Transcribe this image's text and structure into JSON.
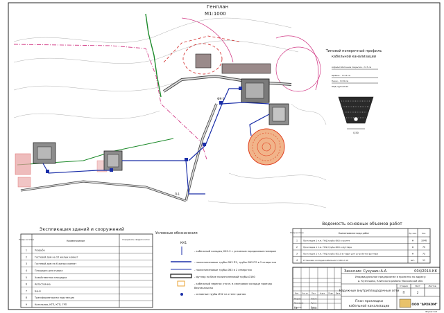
{
  "plan": {
    "title": "Генплан",
    "scale": "М1:1000",
    "road_label": "ФК-1",
    "pipe_label": "П-1"
  },
  "profile": {
    "title": "Типовой поперечный профиль",
    "subtitle": "кабельной канализации",
    "label_1": "Асфальтобетонное покрытие – h=5 см",
    "label_2": "Щебень – h=15 см",
    "label_3": "Песок – h=30 см",
    "label_4": "ПНД труба Ø110",
    "width": "0,50"
  },
  "explication": {
    "title": "Экспликация зданий и сооружений",
    "headers": [
      "Номер на плане",
      "Наименование",
      "Координаты квадрата сетки"
    ],
    "rows": [
      {
        "num": "1",
        "name": "Усадьба"
      },
      {
        "num": "2",
        "name": "Гостевой дом на 10 жилых комнат"
      },
      {
        "num": "3",
        "name": "Гостевой дом на 6 жилых комнат"
      },
      {
        "num": "4",
        "name": "Площадка для отдыха"
      },
      {
        "num": "5",
        "name": "Хозяйственная площадка"
      },
      {
        "num": "6",
        "name": "Автостоянка"
      },
      {
        "num": "7",
        "name": "Баня"
      },
      {
        "num": "8",
        "name": "Трансформаторная подстанция"
      },
      {
        "num": "9",
        "name": "Котельная, КТП, КТП, ГРП"
      }
    ]
  },
  "legend": {
    "title": "Условные обозначения",
    "well_code": "КК1",
    "items": [
      "- кабельный колодец ККС-2 с условным порядковым номером",
      "- полиэтиленовые трубы Ø63 ПЭ, трубы Ø63 ПЭ в 2 отверстия",
      "- полиэтиленовые трубы Ø63 в 2 отверстия",
      "- футляр на базе полиэтиленовой трубы Ø160",
      "- кабельный перенос уточн. в смотровом колодце проезда",
      "- основные трубы Ø32 на стене здания"
    ],
    "sub_item": "Вертикальная"
  },
  "volumes": {
    "title": "Ведомость основных объемов работ",
    "headers": [
      "Номер на плане",
      "Наименование вида работ",
      "Ед. изм.",
      "Кол."
    ],
    "rows": [
      {
        "num": "1",
        "name": "Прокладка 1 п.м. ПНД трубы Ø63 в грунте",
        "unit": "м",
        "qty": "1046"
      },
      {
        "num": "2",
        "name": "Прокладка 1 п.м. ПНД трубы Ø63 в футляре",
        "unit": "м",
        "qty": "70"
      },
      {
        "num": "3",
        "name": "Прокладка 1 п.м. ПНД трубы Ø110 в гофре для устройства футляра",
        "unit": "м",
        "qty": "72"
      },
      {
        "num": "4",
        "name": "Установка колодца кабельного ККС-2-10",
        "unit": "шт.",
        "qty": "11"
      }
    ]
  },
  "title_block": {
    "customer": "Заказчик: Сухушин А.А.",
    "code": "004/2014-КК",
    "project_line1": "Индивидуальное предприятие в проектно по адресу:",
    "project_line2": "д. Кузнецово, Клинского района Московской обл.",
    "section": "Наружные внутриплощадочные сети",
    "stage_hdr": "Стадия",
    "sheet_hdr": "Лист",
    "sheets_hdr": "Листов",
    "stage": "П",
    "sheet": "2",
    "sheets": "",
    "sheet_title_1": "План прокладки",
    "sheet_title_2": "кабельной канализации",
    "company": "ООО \"АРХКОМ\"",
    "roles": [
      "Изм.",
      "Кол.уч.",
      "Лист",
      "№док.",
      "Подп.",
      "Дата"
    ],
    "people": [
      {
        "role": "Разраб.",
        "name": "Лапин"
      },
      {
        "role": "Проверил",
        "name": "Лупов"
      },
      {
        "role": "Н.контр.",
        "name": "Лупов"
      },
      {
        "role": "ГИП",
        "name": "Лупов"
      }
    ],
    "format": "Формат А3"
  },
  "colors": {
    "road": "#4a4a4a",
    "cable": "#1a2ea8",
    "boundary": "#d23b86",
    "green_line": "#1c8a2a",
    "red_grid": "#d02020",
    "accent": "#e04020"
  }
}
